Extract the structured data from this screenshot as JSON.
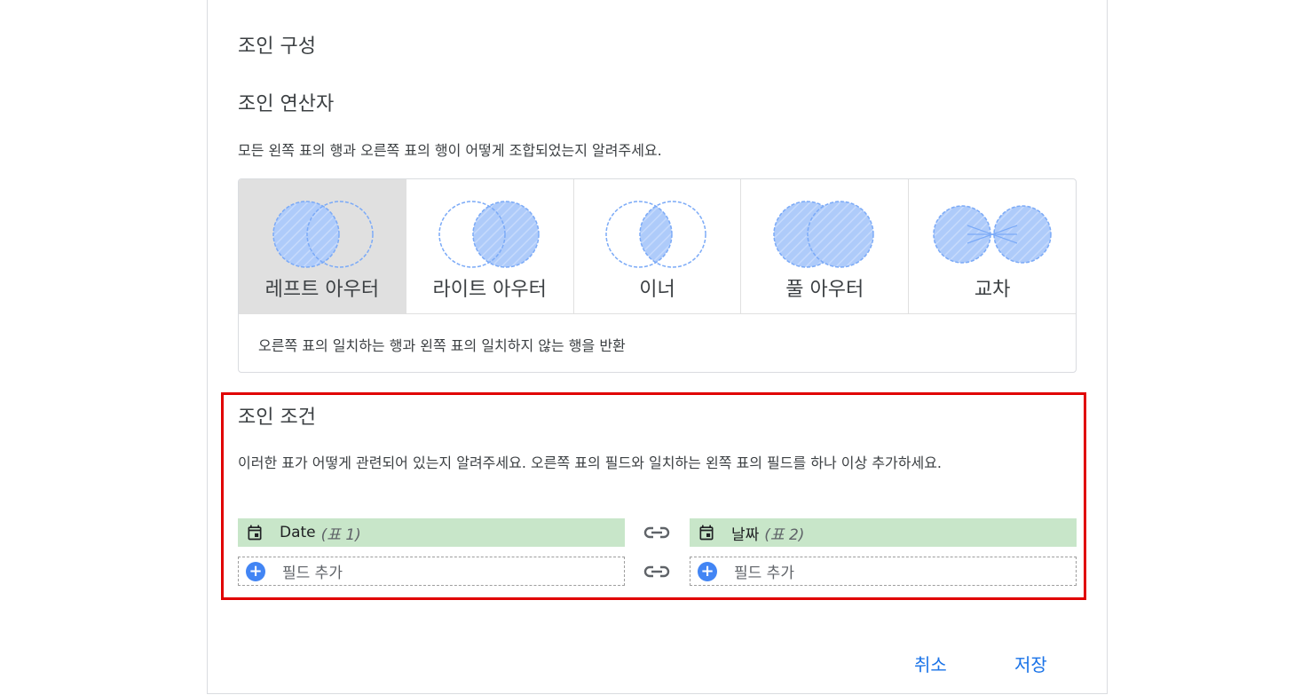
{
  "dialog": {
    "title": "조인 구성",
    "operator_section": {
      "title": "조인 연산자",
      "description": "모든 왼쪽 표의 행과 오른쪽 표의 행이 어떻게 조합되었는지 알려주세요.",
      "options": [
        {
          "label": "레프트 아우터",
          "icon": "left-outer-join-venn-icon",
          "selected": true
        },
        {
          "label": "라이트 아우터",
          "icon": "right-outer-join-venn-icon",
          "selected": false
        },
        {
          "label": "이너",
          "icon": "inner-join-venn-icon",
          "selected": false
        },
        {
          "label": "풀 아우터",
          "icon": "full-outer-join-venn-icon",
          "selected": false
        },
        {
          "label": "교차",
          "icon": "cross-join-venn-icon",
          "selected": false
        }
      ],
      "selected_description": "오른쪽 표의 일치하는 행과 왼쪽 표의 일치하지 않는 행을 반환"
    },
    "condition_section": {
      "title": "조인 조건",
      "description": "이러한 표가 어떻게 관련되어 있는지 알려주세요. 오른쪽 표의 필드와 일치하는 왼쪽 표의 필드를 하나 이상 추가하세요.",
      "left_field": {
        "name": "Date",
        "table": "(표 1)",
        "icon": "calendar-icon"
      },
      "right_field": {
        "name": "날짜",
        "table": "(표 2)",
        "icon": "calendar-icon"
      },
      "add_field_label": "필드 추가"
    },
    "buttons": {
      "cancel": "취소",
      "save": "저장"
    }
  },
  "colors": {
    "accent": "#1a73e8",
    "venn_fill": "#aecbfa",
    "venn_stroke": "#8ab4f8",
    "field_bg": "#c8e6c9",
    "highlight_border": "#e00000",
    "selected_bg": "#e0e0e0"
  }
}
